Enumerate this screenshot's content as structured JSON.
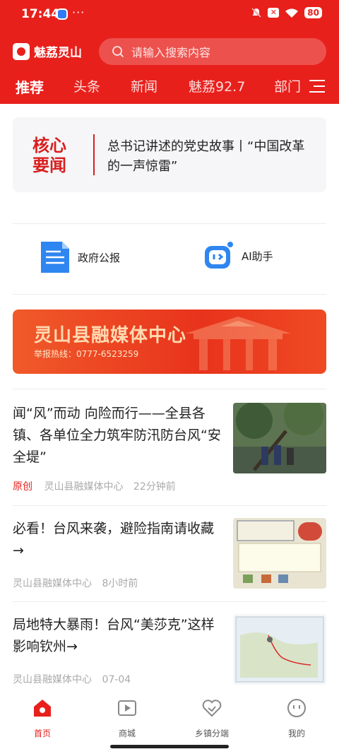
{
  "status": {
    "time": "17:44",
    "battery": "80",
    "more": "···"
  },
  "app": {
    "name": "魅荔灵山"
  },
  "search": {
    "placeholder": "请输入搜索内容"
  },
  "tabs": [
    "推荐",
    "头条",
    "新闻",
    "魅荔92.7",
    "部门"
  ],
  "core_news": {
    "badge_line1": "核心",
    "badge_line2": "要闻",
    "text": "总书记讲述的党史故事丨“中国改革的一声惊雷”"
  },
  "quick_links": [
    {
      "label": "政府公报",
      "icon": "document-icon"
    },
    {
      "label": "AI助手",
      "icon": "robot-icon"
    }
  ],
  "banner": {
    "title": "灵山县融媒体中心",
    "hotline": "举报热线：0777-6523259"
  },
  "news": [
    {
      "title": "闻“风”而动 向险而行——全县各镇、各单位全力筑牢防汛防台风“安全堤”",
      "original": "原创",
      "source": "灵山县融媒体中心",
      "time": "22分钟前"
    },
    {
      "title": "必看！台风来袭，避险指南请收藏→",
      "original": "",
      "source": "灵山县融媒体中心",
      "time": "8小时前"
    },
    {
      "title": "局地特大暴雨！台风“美莎克”这样影响钦州→",
      "original": "",
      "source": "灵山县融媒体中心",
      "time": "07-04"
    }
  ],
  "tabbar": [
    "首页",
    "商城",
    "乡镇分端",
    "我的"
  ],
  "colors": {
    "brand_red": "#e8201c"
  }
}
